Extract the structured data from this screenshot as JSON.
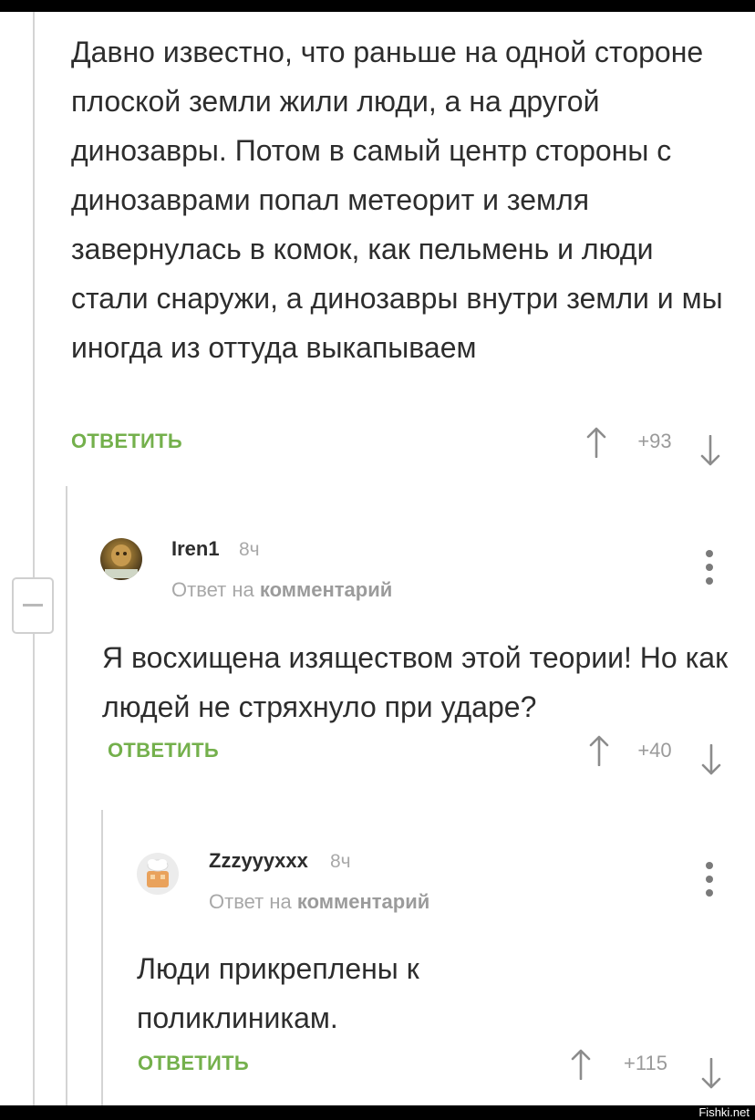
{
  "comment_root": {
    "text": "Давно известно, что раньше на одной стороне плоской земли жили люди, а на другой динозавры. Потом в самый центр стороны с динозаврами попал метеорит и земля завернулась в комок, как пельмень и люди стали снаружи, а динозавры внутри земли и мы иногда из оттуда выкапываем",
    "reply_label": "ОТВЕТИТЬ",
    "rating": "+93"
  },
  "comment_iren": {
    "author": "Iren1",
    "time": "8ч",
    "reply_to_prefix": "Ответ на",
    "reply_to_link": "комментарий",
    "text": "Я восхищена изяществом этой теории! Но как людей не стряхнуло при ударе?",
    "reply_label": "ОТВЕТИТЬ",
    "rating": "+40"
  },
  "comment_zzz": {
    "author": "Zzzyyyxxx",
    "time": "8ч",
    "reply_to_prefix": "Ответ на",
    "reply_to_link": "комментарий",
    "text": "Люди прикреплены к поликлиникам.",
    "reply_label": "ОТВЕТИТЬ",
    "rating": "+115"
  },
  "icons": {
    "upvote": "arrow-up-icon",
    "downvote": "arrow-down-icon",
    "menu": "more-vertical-icon",
    "collapse": "minus-icon"
  },
  "colors": {
    "reply_green": "#74b04c",
    "text": "#2d2d2d",
    "muted": "#a8a8a8",
    "thread_line": "#d4d4d4"
  },
  "watermark": "Fishki.net"
}
